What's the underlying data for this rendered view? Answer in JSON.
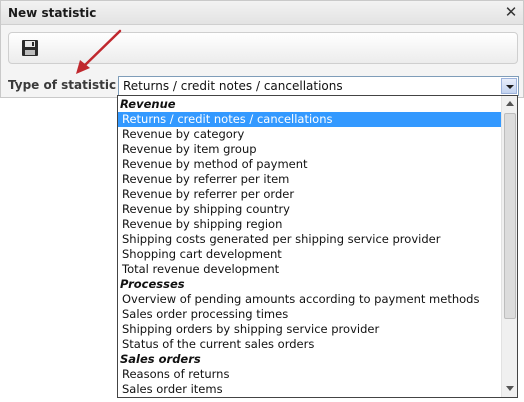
{
  "dialog": {
    "title": "New statistic",
    "close_icon": "close-icon",
    "save_icon": "floppy-disk-save-icon"
  },
  "form": {
    "type_label": "Type of statistic",
    "type_value": "Returns / credit notes / cancellations"
  },
  "dropdown": {
    "rows": [
      {
        "label": "Revenue",
        "group": true
      },
      {
        "label": "Returns / credit notes / cancellations",
        "selected": true
      },
      {
        "label": "Revenue by category"
      },
      {
        "label": "Revenue by item group"
      },
      {
        "label": "Revenue by method of payment"
      },
      {
        "label": "Revenue by referrer per item"
      },
      {
        "label": "Revenue by referrer per order"
      },
      {
        "label": "Revenue by shipping country"
      },
      {
        "label": "Revenue by shipping region"
      },
      {
        "label": "Shipping costs generated per shipping service provider"
      },
      {
        "label": "Shopping cart development"
      },
      {
        "label": "Total revenue development"
      },
      {
        "label": "Processes",
        "group": true
      },
      {
        "label": "Overview of pending amounts according to payment methods"
      },
      {
        "label": "Sales order processing times"
      },
      {
        "label": "Shipping orders by shipping service provider"
      },
      {
        "label": "Status of the current sales orders"
      },
      {
        "label": "Sales orders",
        "group": true
      },
      {
        "label": "Reasons of returns"
      },
      {
        "label": "Sales order items"
      }
    ]
  },
  "colors": {
    "selection": "#3399ff",
    "annotation_arrow": "#c0282e"
  }
}
